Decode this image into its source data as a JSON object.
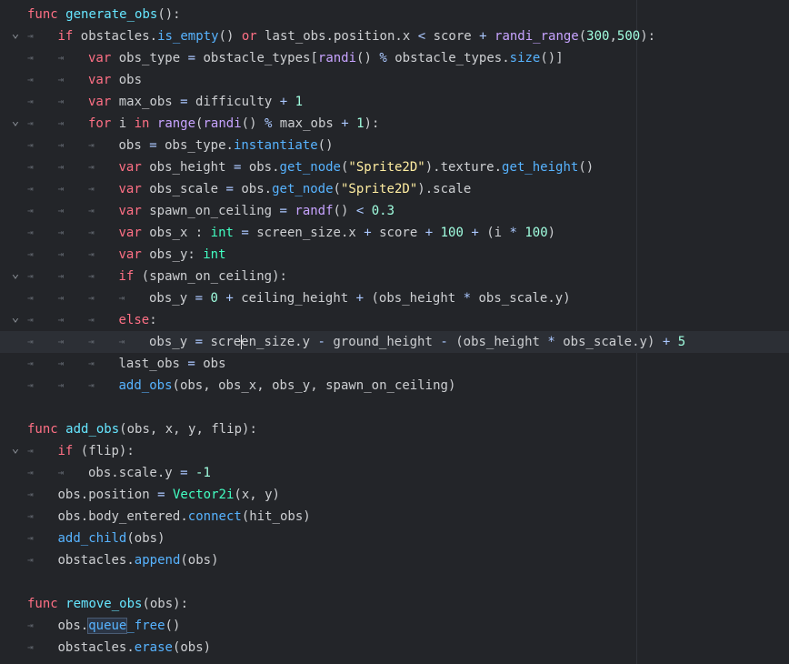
{
  "editor": {
    "current_line": 15,
    "lines": [
      {
        "fold": "",
        "indent": 0,
        "tokens": [
          {
            "t": "func",
            "c": "kw"
          },
          {
            "t": " ",
            "c": "tx"
          },
          {
            "t": "generate_obs",
            "c": "fn"
          },
          {
            "t": "():",
            "c": "tx"
          }
        ]
      },
      {
        "fold": "v",
        "indent": 1,
        "tokens": [
          {
            "t": "if",
            "c": "kw"
          },
          {
            "t": " obstacles.",
            "c": "tx"
          },
          {
            "t": "is_empty",
            "c": "mt"
          },
          {
            "t": "() ",
            "c": "tx"
          },
          {
            "t": "or",
            "c": "kw"
          },
          {
            "t": " last_obs.",
            "c": "tx"
          },
          {
            "t": "position",
            "c": "tx"
          },
          {
            "t": ".x",
            "c": "tx"
          },
          {
            "t": " < ",
            "c": "op"
          },
          {
            "t": "score",
            "c": "tx"
          },
          {
            "t": " + ",
            "c": "op"
          },
          {
            "t": "randi_range",
            "c": "bi"
          },
          {
            "t": "(",
            "c": "tx"
          },
          {
            "t": "300",
            "c": "nm"
          },
          {
            "t": ",",
            "c": "tx"
          },
          {
            "t": "500",
            "c": "nm"
          },
          {
            "t": "):",
            "c": "tx"
          }
        ]
      },
      {
        "fold": "",
        "indent": 2,
        "tokens": [
          {
            "t": "var",
            "c": "kw"
          },
          {
            "t": " obs_type ",
            "c": "tx"
          },
          {
            "t": "=",
            "c": "op"
          },
          {
            "t": " obstacle_types[",
            "c": "tx"
          },
          {
            "t": "randi",
            "c": "bi"
          },
          {
            "t": "() ",
            "c": "tx"
          },
          {
            "t": "%",
            "c": "op"
          },
          {
            "t": " obstacle_types.",
            "c": "tx"
          },
          {
            "t": "size",
            "c": "mt"
          },
          {
            "t": "()]",
            "c": "tx"
          }
        ]
      },
      {
        "fold": "",
        "indent": 2,
        "tokens": [
          {
            "t": "var",
            "c": "kw"
          },
          {
            "t": " obs",
            "c": "tx"
          }
        ]
      },
      {
        "fold": "",
        "indent": 2,
        "tokens": [
          {
            "t": "var",
            "c": "kw"
          },
          {
            "t": " max_obs ",
            "c": "tx"
          },
          {
            "t": "=",
            "c": "op"
          },
          {
            "t": " difficulty ",
            "c": "tx"
          },
          {
            "t": "+",
            "c": "op"
          },
          {
            "t": " ",
            "c": "tx"
          },
          {
            "t": "1",
            "c": "nm"
          }
        ]
      },
      {
        "fold": "v",
        "indent": 2,
        "tokens": [
          {
            "t": "for",
            "c": "kw"
          },
          {
            "t": " i ",
            "c": "tx"
          },
          {
            "t": "in",
            "c": "kw"
          },
          {
            "t": " ",
            "c": "tx"
          },
          {
            "t": "range",
            "c": "bi"
          },
          {
            "t": "(",
            "c": "tx"
          },
          {
            "t": "randi",
            "c": "bi"
          },
          {
            "t": "() ",
            "c": "tx"
          },
          {
            "t": "%",
            "c": "op"
          },
          {
            "t": " max_obs ",
            "c": "tx"
          },
          {
            "t": "+",
            "c": "op"
          },
          {
            "t": " ",
            "c": "tx"
          },
          {
            "t": "1",
            "c": "nm"
          },
          {
            "t": "):",
            "c": "tx"
          }
        ]
      },
      {
        "fold": "",
        "indent": 3,
        "tokens": [
          {
            "t": "obs ",
            "c": "tx"
          },
          {
            "t": "=",
            "c": "op"
          },
          {
            "t": " obs_type.",
            "c": "tx"
          },
          {
            "t": "instantiate",
            "c": "mt"
          },
          {
            "t": "()",
            "c": "tx"
          }
        ]
      },
      {
        "fold": "",
        "indent": 3,
        "tokens": [
          {
            "t": "var",
            "c": "kw"
          },
          {
            "t": " obs_height ",
            "c": "tx"
          },
          {
            "t": "=",
            "c": "op"
          },
          {
            "t": " obs.",
            "c": "tx"
          },
          {
            "t": "get_node",
            "c": "mt"
          },
          {
            "t": "(",
            "c": "tx"
          },
          {
            "t": "\"Sprite2D\"",
            "c": "st"
          },
          {
            "t": ").texture.",
            "c": "tx"
          },
          {
            "t": "get_height",
            "c": "mt"
          },
          {
            "t": "()",
            "c": "tx"
          }
        ]
      },
      {
        "fold": "",
        "indent": 3,
        "tokens": [
          {
            "t": "var",
            "c": "kw"
          },
          {
            "t": " obs_scale ",
            "c": "tx"
          },
          {
            "t": "=",
            "c": "op"
          },
          {
            "t": " obs.",
            "c": "tx"
          },
          {
            "t": "get_node",
            "c": "mt"
          },
          {
            "t": "(",
            "c": "tx"
          },
          {
            "t": "\"Sprite2D\"",
            "c": "st"
          },
          {
            "t": ").scale",
            "c": "tx"
          }
        ]
      },
      {
        "fold": "",
        "indent": 3,
        "tokens": [
          {
            "t": "var",
            "c": "kw"
          },
          {
            "t": " spawn_on_ceiling ",
            "c": "tx"
          },
          {
            "t": "=",
            "c": "op"
          },
          {
            "t": " ",
            "c": "tx"
          },
          {
            "t": "randf",
            "c": "bi"
          },
          {
            "t": "() ",
            "c": "tx"
          },
          {
            "t": "<",
            "c": "op"
          },
          {
            "t": " ",
            "c": "tx"
          },
          {
            "t": "0.3",
            "c": "nm"
          }
        ]
      },
      {
        "fold": "",
        "indent": 3,
        "tokens": [
          {
            "t": "var",
            "c": "kw"
          },
          {
            "t": " obs_x : ",
            "c": "tx"
          },
          {
            "t": "int",
            "c": "tp"
          },
          {
            "t": " ",
            "c": "tx"
          },
          {
            "t": "=",
            "c": "op"
          },
          {
            "t": " screen_size.x ",
            "c": "tx"
          },
          {
            "t": "+",
            "c": "op"
          },
          {
            "t": " score ",
            "c": "tx"
          },
          {
            "t": "+",
            "c": "op"
          },
          {
            "t": " ",
            "c": "tx"
          },
          {
            "t": "100",
            "c": "nm"
          },
          {
            "t": " ",
            "c": "tx"
          },
          {
            "t": "+",
            "c": "op"
          },
          {
            "t": " (i ",
            "c": "tx"
          },
          {
            "t": "*",
            "c": "op"
          },
          {
            "t": " ",
            "c": "tx"
          },
          {
            "t": "100",
            "c": "nm"
          },
          {
            "t": ")",
            "c": "tx"
          }
        ]
      },
      {
        "fold": "",
        "indent": 3,
        "tokens": [
          {
            "t": "var",
            "c": "kw"
          },
          {
            "t": " obs_y: ",
            "c": "tx"
          },
          {
            "t": "int",
            "c": "tp"
          }
        ]
      },
      {
        "fold": "v",
        "indent": 3,
        "tokens": [
          {
            "t": "if",
            "c": "kw"
          },
          {
            "t": " (spawn_on_ceiling):",
            "c": "tx"
          }
        ]
      },
      {
        "fold": "",
        "indent": 4,
        "tokens": [
          {
            "t": "obs_y ",
            "c": "tx"
          },
          {
            "t": "=",
            "c": "op"
          },
          {
            "t": " ",
            "c": "tx"
          },
          {
            "t": "0",
            "c": "nm"
          },
          {
            "t": " ",
            "c": "tx"
          },
          {
            "t": "+",
            "c": "op"
          },
          {
            "t": " ceiling_height ",
            "c": "tx"
          },
          {
            "t": "+",
            "c": "op"
          },
          {
            "t": " (obs_height ",
            "c": "tx"
          },
          {
            "t": "*",
            "c": "op"
          },
          {
            "t": " obs_scale.y)",
            "c": "tx"
          }
        ]
      },
      {
        "fold": "v",
        "indent": 3,
        "tokens": [
          {
            "t": "else",
            "c": "kw"
          },
          {
            "t": ":",
            "c": "tx"
          }
        ]
      },
      {
        "fold": "",
        "indent": 4,
        "tokens": [
          {
            "t": "obs_y ",
            "c": "tx"
          },
          {
            "t": "=",
            "c": "op"
          },
          {
            "t": " scre",
            "c": "tx"
          },
          {
            "t": "|",
            "c": "caret"
          },
          {
            "t": "en_size.y ",
            "c": "tx"
          },
          {
            "t": "-",
            "c": "op"
          },
          {
            "t": " ground_height ",
            "c": "tx"
          },
          {
            "t": "-",
            "c": "op"
          },
          {
            "t": " (obs_height ",
            "c": "tx"
          },
          {
            "t": "*",
            "c": "op"
          },
          {
            "t": " obs_scale.y) ",
            "c": "tx"
          },
          {
            "t": "+",
            "c": "op"
          },
          {
            "t": " ",
            "c": "tx"
          },
          {
            "t": "5",
            "c": "nm"
          }
        ]
      },
      {
        "fold": "",
        "indent": 3,
        "tokens": [
          {
            "t": "last_obs ",
            "c": "tx"
          },
          {
            "t": "=",
            "c": "op"
          },
          {
            "t": " obs",
            "c": "tx"
          }
        ]
      },
      {
        "fold": "",
        "indent": 3,
        "tokens": [
          {
            "t": "add_obs",
            "c": "mt"
          },
          {
            "t": "(obs, obs_x, obs_y, spawn_on_ceiling)",
            "c": "tx"
          }
        ]
      },
      {
        "fold": "",
        "indent": 0,
        "tokens": []
      },
      {
        "fold": "",
        "indent": 0,
        "tokens": [
          {
            "t": "func",
            "c": "kw"
          },
          {
            "t": " ",
            "c": "tx"
          },
          {
            "t": "add_obs",
            "c": "fn"
          },
          {
            "t": "(obs, x, y, flip):",
            "c": "tx"
          }
        ]
      },
      {
        "fold": "v",
        "indent": 1,
        "tokens": [
          {
            "t": "if",
            "c": "kw"
          },
          {
            "t": " (flip):",
            "c": "tx"
          }
        ]
      },
      {
        "fold": "",
        "indent": 2,
        "tokens": [
          {
            "t": "obs.scale.y ",
            "c": "tx"
          },
          {
            "t": "=",
            "c": "op"
          },
          {
            "t": " ",
            "c": "tx"
          },
          {
            "t": "-1",
            "c": "nm"
          }
        ]
      },
      {
        "fold": "",
        "indent": 1,
        "tokens": [
          {
            "t": "obs.",
            "c": "tx"
          },
          {
            "t": "position",
            "c": "tx"
          },
          {
            "t": " ",
            "c": "tx"
          },
          {
            "t": "=",
            "c": "op"
          },
          {
            "t": " ",
            "c": "tx"
          },
          {
            "t": "Vector2i",
            "c": "tp"
          },
          {
            "t": "(x, y)",
            "c": "tx"
          }
        ]
      },
      {
        "fold": "",
        "indent": 1,
        "tokens": [
          {
            "t": "obs.body_entered.",
            "c": "tx"
          },
          {
            "t": "connect",
            "c": "mt"
          },
          {
            "t": "(hit_obs)",
            "c": "tx"
          }
        ]
      },
      {
        "fold": "",
        "indent": 1,
        "tokens": [
          {
            "t": "add_child",
            "c": "mt"
          },
          {
            "t": "(obs)",
            "c": "tx"
          }
        ]
      },
      {
        "fold": "",
        "indent": 1,
        "tokens": [
          {
            "t": "obstacles.",
            "c": "tx"
          },
          {
            "t": "append",
            "c": "mt"
          },
          {
            "t": "(obs)",
            "c": "tx"
          }
        ]
      },
      {
        "fold": "",
        "indent": 0,
        "tokens": []
      },
      {
        "fold": "",
        "indent": 0,
        "tokens": [
          {
            "t": "func",
            "c": "kw"
          },
          {
            "t": " ",
            "c": "tx"
          },
          {
            "t": "remove_obs",
            "c": "fn"
          },
          {
            "t": "(obs):",
            "c": "tx"
          }
        ]
      },
      {
        "fold": "",
        "indent": 1,
        "tokens": [
          {
            "t": "obs.",
            "c": "tx"
          },
          {
            "t": "queue",
            "c": "mt hl"
          },
          {
            "t": "_free",
            "c": "mt"
          },
          {
            "t": "()",
            "c": "tx"
          }
        ]
      },
      {
        "fold": "",
        "indent": 1,
        "tokens": [
          {
            "t": "obstacles.",
            "c": "tx"
          },
          {
            "t": "erase",
            "c": "mt"
          },
          {
            "t": "(obs)",
            "c": "tx"
          }
        ]
      }
    ]
  },
  "icons": {
    "fold": "chevron-down-icon",
    "tab": "tab-indent-icon"
  },
  "colors": {
    "background": "#232529",
    "keyword": "#ff7085",
    "function_name": "#66e6ff",
    "method": "#57b3ff",
    "builtin": "#c7a3ff",
    "type": "#42ffc2",
    "string": "#ffeda1",
    "number": "#a1ffe0",
    "text": "#cdcfd2"
  }
}
